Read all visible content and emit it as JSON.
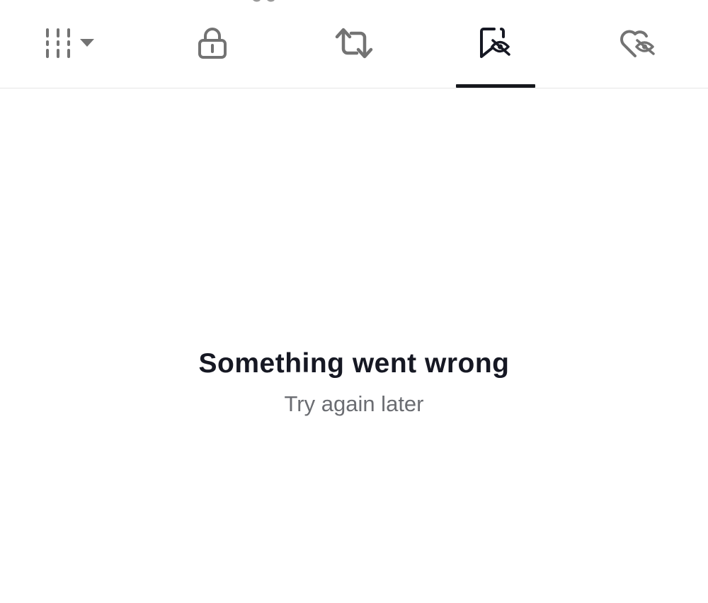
{
  "colors": {
    "icon_inactive": "#737373",
    "icon_active": "#161823",
    "indicator": "#16181d",
    "divider": "#e6e6e6",
    "title_text": "#161823",
    "subtitle_text": "#6b6d72",
    "background": "#ffffff"
  },
  "tabs": [
    {
      "icon": "grid-dropdown-icon",
      "active": false
    },
    {
      "icon": "lock-icon",
      "active": false
    },
    {
      "icon": "repost-icon",
      "active": false
    },
    {
      "icon": "bookmark-eye-hidden-icon",
      "active": true
    },
    {
      "icon": "heart-eye-hidden-icon",
      "active": false
    }
  ],
  "error_state": {
    "title": "Something went wrong",
    "subtitle": "Try again later"
  }
}
